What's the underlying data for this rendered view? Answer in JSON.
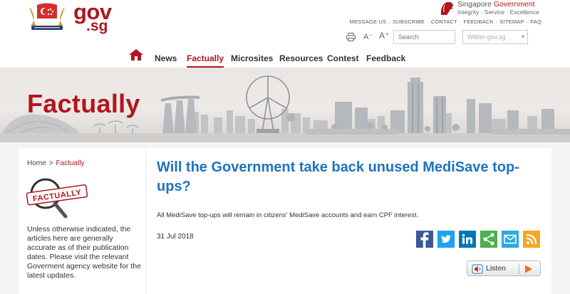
{
  "header": {
    "logo": {
      "gov": "gov",
      "sg": ".sg"
    },
    "sg_government": {
      "line1_a": "Singapore ",
      "line1_b": "Government",
      "line2": "Integrity · Service · Excellence"
    },
    "top_links": [
      "MESSAGE US",
      "SUBSCRIBE",
      "CONTACT",
      "FEEDBACK",
      "SITEMAP",
      "FAQ"
    ],
    "text_smaller": "A⁻",
    "text_larger": "A⁺",
    "search": {
      "placeholder": "Search",
      "scope": "Within gov.sg"
    },
    "nav": [
      "News",
      "Factually",
      "Microsites",
      "Resources",
      "Contest",
      "Feedback"
    ],
    "active_nav": "Factually"
  },
  "banner": {
    "title": "Factually"
  },
  "sidebar": {
    "breadcrumb_home": "Home",
    "breadcrumb_sep": ">",
    "breadcrumb_current": "Factually",
    "badge_text": "FACTUALLY",
    "note": "Unless otherwise indicated, the articles here are generally accurate as of their publication dates. Please visit the relevant Goverment agency website for the latest updates."
  },
  "article": {
    "title": "Will the Government take back unused MediSave top-ups?",
    "summary": "All MediSave top-ups will remain in citizens' MediSave accounts and earn CPF interest.",
    "date": "31 Jul 2018",
    "share": [
      {
        "name": "facebook-icon",
        "color": "#3b5998"
      },
      {
        "name": "twitter-icon",
        "color": "#1da1f2"
      },
      {
        "name": "linkedin-icon",
        "color": "#0077b5"
      },
      {
        "name": "share-icon",
        "color": "#4caf50"
      },
      {
        "name": "email-icon",
        "color": "#29a9e0"
      },
      {
        "name": "rss-icon",
        "color": "#f5a623"
      }
    ],
    "listen_label": "Listen"
  },
  "colors": {
    "brand_red": "#b0161f",
    "title_blue": "#1e73be"
  }
}
